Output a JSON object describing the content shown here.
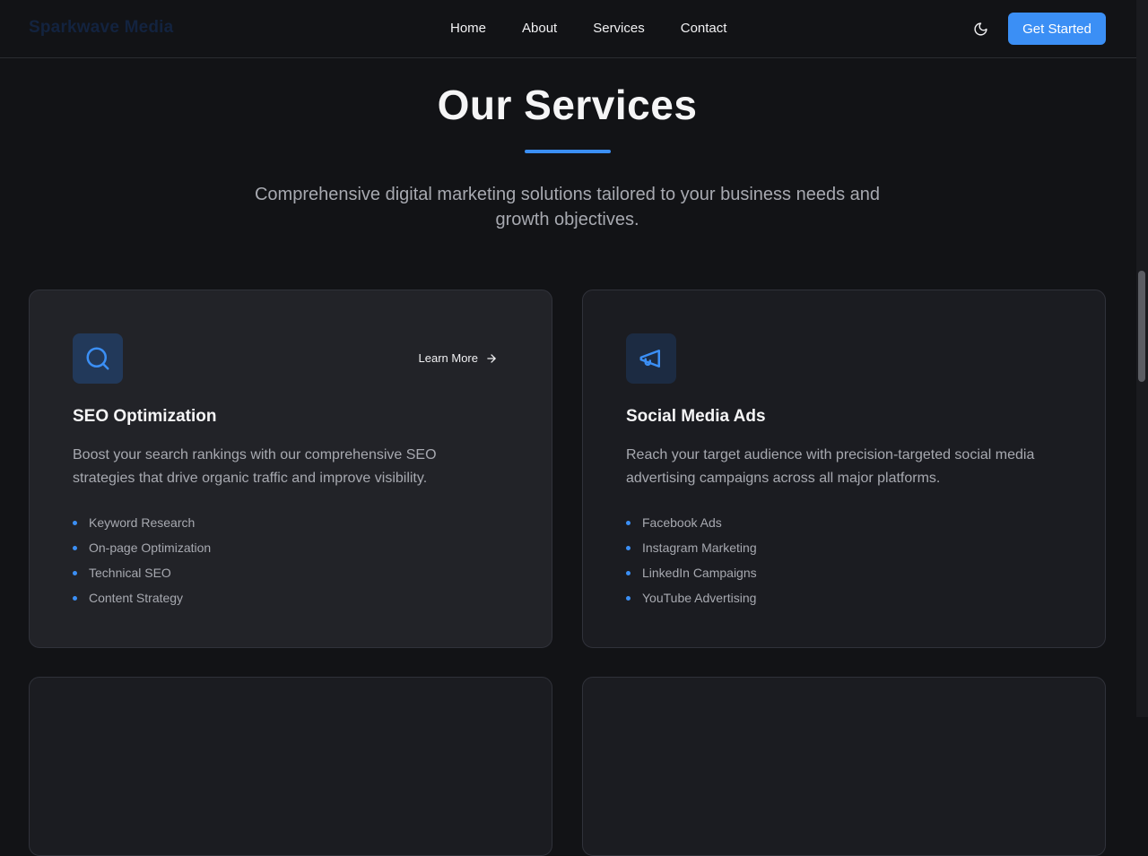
{
  "header": {
    "logo": "Sparkwave Media",
    "nav": [
      "Home",
      "About",
      "Services",
      "Contact"
    ],
    "theme_icon": "moon-icon",
    "cta_label": "Get Started"
  },
  "section": {
    "title": "Our Services",
    "subtitle": "Comprehensive digital marketing solutions tailored to your business needs and growth objectives."
  },
  "cards": [
    {
      "icon": "search-icon",
      "title": "SEO Optimization",
      "learn_more": "Learn More",
      "description": "Boost your search rankings with our comprehensive SEO strategies that drive organic traffic and improve visibility.",
      "features": [
        "Keyword Research",
        "On-page Optimization",
        "Technical SEO",
        "Content Strategy"
      ]
    },
    {
      "icon": "megaphone-icon",
      "title": "Social Media Ads",
      "description": "Reach your target audience with precision-targeted social media advertising campaigns across all major platforms.",
      "features": [
        "Facebook Ads",
        "Instagram Marketing",
        "LinkedIn Campaigns",
        "YouTube Advertising"
      ]
    }
  ],
  "colors": {
    "accent": "#3b8ff5",
    "background": "#121316",
    "card_bg": "#1b1c21",
    "card_bg_hover": "#222328",
    "text_muted": "#a7a9b0"
  }
}
